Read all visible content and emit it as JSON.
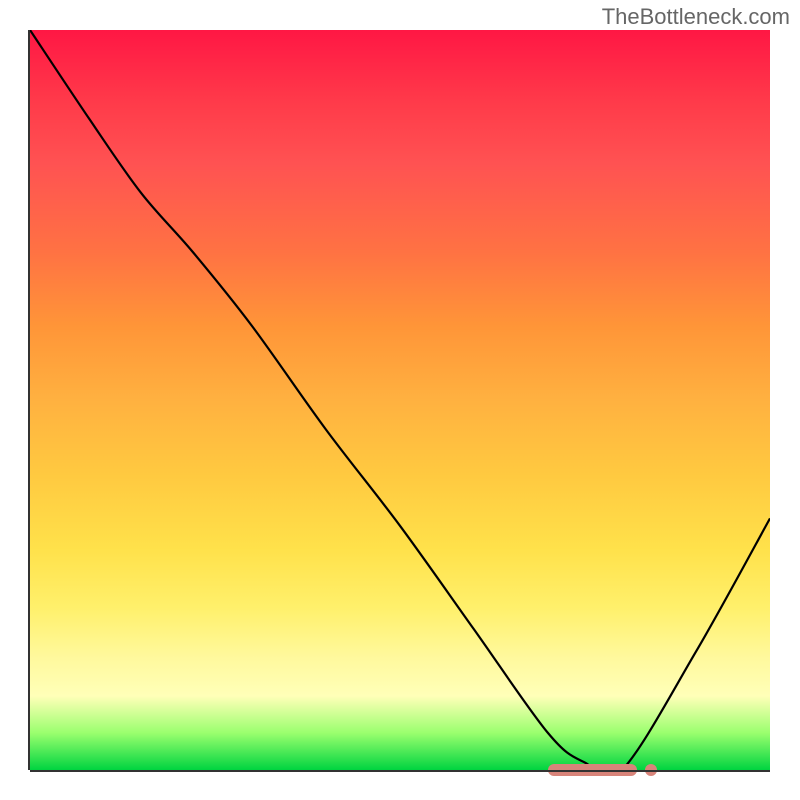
{
  "watermark": "TheBottleneck.com",
  "chart_data": {
    "type": "line",
    "title": "",
    "xlabel": "",
    "ylabel": "",
    "xlim": [
      0,
      100
    ],
    "ylim": [
      0,
      100
    ],
    "x": [
      0,
      8,
      15,
      22,
      30,
      40,
      50,
      60,
      70,
      75,
      80,
      90,
      100
    ],
    "values": [
      100,
      88,
      78,
      70,
      60,
      46,
      33,
      19,
      5,
      1,
      0,
      16,
      34
    ],
    "background_gradient": {
      "top": "#ff1744",
      "mid": "#ffc940",
      "bottom": "#00d440"
    },
    "marker": {
      "x_start": 70,
      "x_end": 82,
      "y": 0
    }
  }
}
